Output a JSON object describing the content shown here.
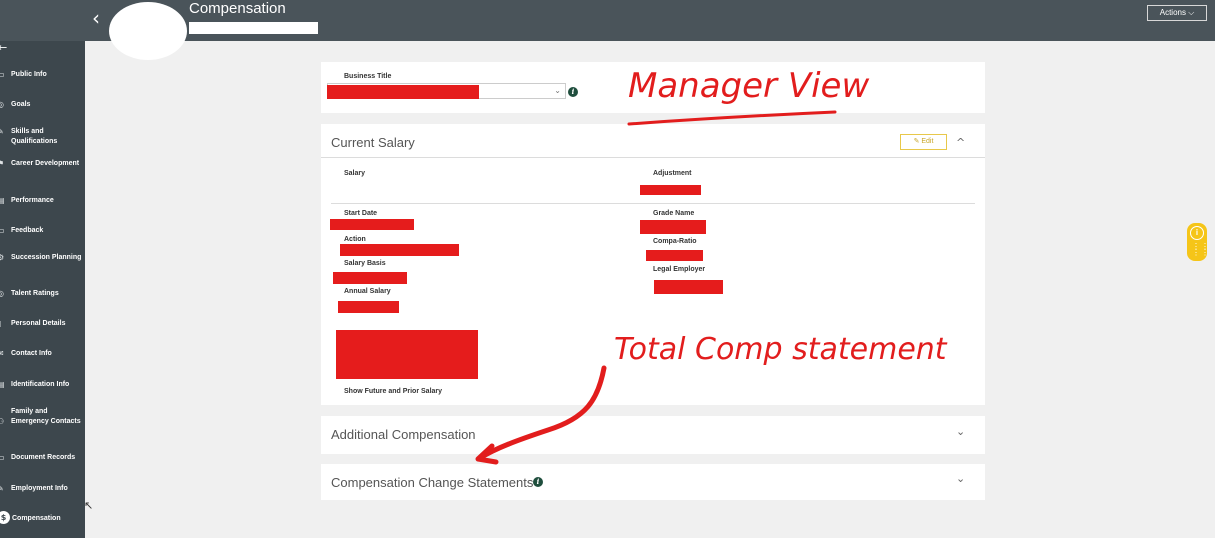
{
  "header": {
    "back": "‹",
    "title": "Compensation",
    "actions_label": "Actions ⌵"
  },
  "sidebar": {
    "back": "←",
    "items": [
      {
        "label": "Public Info",
        "icon": "▭"
      },
      {
        "label": "Goals",
        "icon": "◎"
      },
      {
        "label": "Skills and Qualifications",
        "icon": "✎"
      },
      {
        "label": "Career Development",
        "icon": "⚑"
      },
      {
        "label": "Performance",
        "icon": "▤"
      },
      {
        "label": "Feedback",
        "icon": "▭"
      },
      {
        "label": "Succession Planning",
        "icon": "⚙"
      },
      {
        "label": "Talent Ratings",
        "icon": "◎"
      },
      {
        "label": "Personal Details",
        "icon": "▯"
      },
      {
        "label": "Contact Info",
        "icon": "✉"
      },
      {
        "label": "Identification Info",
        "icon": "▤"
      },
      {
        "label": "Family and Emergency Contacts",
        "icon": "⚇"
      },
      {
        "label": "Document Records",
        "icon": "▭"
      },
      {
        "label": "Employment Info",
        "icon": "✎"
      },
      {
        "label": "Compensation",
        "icon": "$"
      }
    ]
  },
  "business_title": {
    "label": "Business Title"
  },
  "current_salary": {
    "title": "Current Salary",
    "edit_label": "✎  Edit",
    "collapse": "^",
    "salary_label": "Salary",
    "adjustment_label": "Adjustment",
    "start_date_label": "Start Date",
    "grade_name_label": "Grade Name",
    "action_label": "Action",
    "compa_ratio_label": "Compa-Ratio",
    "salary_basis_label": "Salary Basis",
    "legal_employer_label": "Legal Employer",
    "annual_salary_label": "Annual Salary",
    "show_link": "Show Future and Prior Salary"
  },
  "additional_comp": {
    "title": "Additional Compensation",
    "expand": "⌄"
  },
  "comp_change": {
    "title": "Compensation Change Statements",
    "expand": "⌄"
  },
  "annotations": {
    "manager_view": "Manager View",
    "total_comp": "Total Comp statement"
  },
  "colors": {
    "topbar": "#4a545a",
    "sidebar": "#3d474d",
    "redaction": "#e51c1c",
    "edit_accent": "#e8c84a",
    "widget": "#f5c518"
  }
}
